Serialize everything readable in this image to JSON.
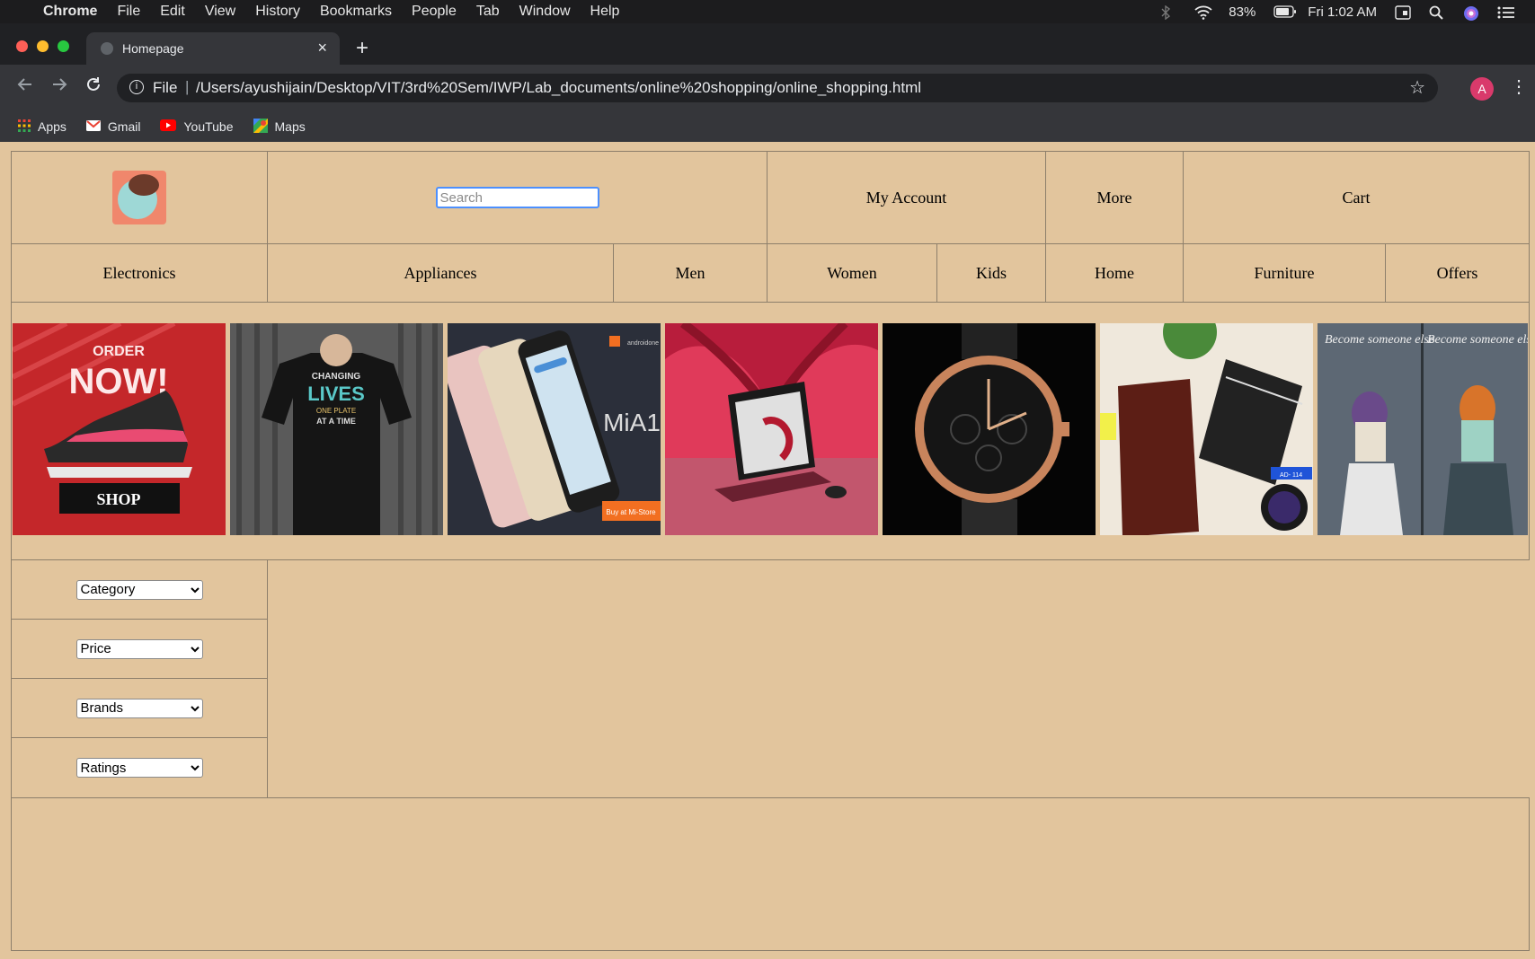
{
  "menubar": {
    "apple": "",
    "app_name": "Chrome",
    "items": [
      "File",
      "Edit",
      "View",
      "History",
      "Bookmarks",
      "People",
      "Tab",
      "Window",
      "Help"
    ],
    "battery": "83%",
    "clock": "Fri 1:02 AM"
  },
  "browser": {
    "tab_title": "Homepage",
    "tab_close": "×",
    "new_tab": "+",
    "url_scheme": "File",
    "url": "/Users/ayushijain/Desktop/VIT/3rd%20Sem/IWP/Lab_documents/online%20shopping/online_shopping.html",
    "avatar_letter": "A",
    "bookmarks": [
      "Apps",
      "Gmail",
      "YouTube",
      "Maps"
    ]
  },
  "header": {
    "search_placeholder": "Search",
    "my_account": "My Account",
    "more": "More",
    "cart": "Cart"
  },
  "categories": [
    "Electronics",
    "Appliances",
    "Men",
    "Women",
    "Kids",
    "Home",
    "Furniture",
    "Offers"
  ],
  "banners": {
    "order_now": {
      "top": "ORDER",
      "big": "NOW!",
      "button": "SHOP"
    },
    "tshirt": {
      "line1": "CHANGING",
      "line2": "LIVES",
      "line3": "ONE PLATE",
      "line4": "AT A TIME"
    },
    "phone": {
      "brand": "androidone",
      "model": "MiA1",
      "cta": "Buy at Mi-Store"
    },
    "diary": {
      "tag": "AD- 114"
    },
    "books": {
      "text": "Become someone else"
    }
  },
  "filters": [
    "Category",
    "Price",
    "Brands",
    "Ratings"
  ],
  "colors": {
    "page_bg": "#e2c59d",
    "border": "#8d7f6b",
    "focus": "#4d90fe"
  }
}
